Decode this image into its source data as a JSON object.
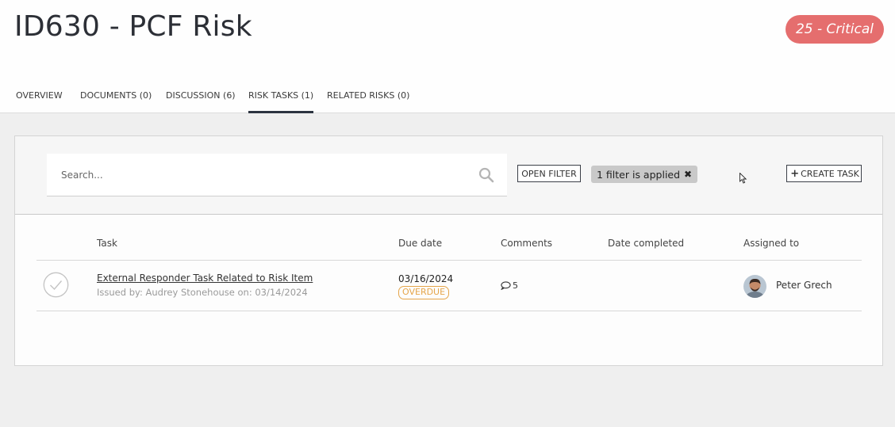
{
  "header": {
    "title": "ID630 - PCF Risk",
    "risk_badge": "25 - Critical",
    "risk_color": "#e56e6e"
  },
  "tabs": [
    {
      "label": "OVERVIEW",
      "active": false
    },
    {
      "label": "DOCUMENTS (0)",
      "active": false
    },
    {
      "label": "DISCUSSION (6)",
      "active": false
    },
    {
      "label": "RISK TASKS (1)",
      "active": true
    },
    {
      "label": "RELATED RISKS (0)",
      "active": false
    }
  ],
  "toolbar": {
    "search_placeholder": "Search...",
    "open_filter_label": "OPEN FILTER",
    "filter_chip_label": "1 filter is applied",
    "create_task_label": "CREATE TASK"
  },
  "table": {
    "columns": [
      "Task",
      "Due date",
      "Comments",
      "Date completed",
      "Assigned to"
    ],
    "rows": [
      {
        "task": "External Responder Task Related to Risk Item",
        "issued": "Issued by: Audrey Stonehouse on: 03/14/2024",
        "due_date": "03/16/2024",
        "status": "OVERDUE",
        "comments": "5",
        "date_completed": "",
        "assignee": "Peter Grech"
      }
    ]
  },
  "icons": [
    "search-icon",
    "close-icon",
    "plus-icon",
    "checkmark-circle-icon",
    "comment-icon",
    "avatar",
    "cursor-icon"
  ]
}
